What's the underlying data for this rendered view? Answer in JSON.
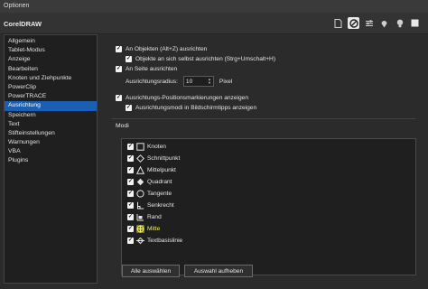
{
  "window": {
    "title": "Optionen"
  },
  "header": {
    "title": "CorelDRAW"
  },
  "header_icons": [
    "page-icon",
    "no-entry-icon",
    "sliders-icon",
    "pin-icon",
    "bulb-icon",
    "square-icon"
  ],
  "sidebar": {
    "items": [
      {
        "label": "Allgemein"
      },
      {
        "label": "Tablet-Modus"
      },
      {
        "label": "Anzeige"
      },
      {
        "label": "Bearbeiten"
      },
      {
        "label": "Knoten und Ziehpunkte"
      },
      {
        "label": "PowerClip"
      },
      {
        "label": "PowerTRACE"
      },
      {
        "label": "Ausrichtung",
        "selected": true
      },
      {
        "label": "Speichern"
      },
      {
        "label": "Text"
      },
      {
        "label": "Stifteinstellungen"
      },
      {
        "label": "Warnungen"
      },
      {
        "label": "VBA"
      },
      {
        "label": "Plugins"
      }
    ]
  },
  "options": {
    "snap_to_objects": "An Objekten  (Alt+Z) ausrichten",
    "snap_to_self": "Objekte an sich selbst ausrichten  (Strg+Umschalt+H)",
    "snap_to_page": "An Seite ausrichten",
    "radius_label": "Ausrichtungsradius:",
    "radius_value": "10",
    "radius_unit": "Pixel",
    "show_markers": "Ausrichtungs-Positionsmarkierungen anzeigen",
    "show_tooltips": "Ausrichtungsmodi in Bildschirmtipps anzeigen"
  },
  "modi": {
    "label": "Modi",
    "items": [
      {
        "label": "Knoten",
        "icon": "square-node-icon"
      },
      {
        "label": "Schnittpunkt",
        "icon": "intersection-icon"
      },
      {
        "label": "Mittelpunkt",
        "icon": "midpoint-icon"
      },
      {
        "label": "Quadrant",
        "icon": "quadrant-icon"
      },
      {
        "label": "Tangente",
        "icon": "tangent-icon"
      },
      {
        "label": "Senkrecht",
        "icon": "perpendicular-icon"
      },
      {
        "label": "Rand",
        "icon": "edge-icon"
      },
      {
        "label": "Mitte",
        "icon": "center-icon",
        "highlighted": true
      },
      {
        "label": "Textbasislinie",
        "icon": "text-baseline-icon"
      }
    ]
  },
  "buttons": {
    "select_all": "Alle auswählen",
    "deselect": "Auswahl aufheben"
  },
  "colors": {
    "selection": "#1a5fb4",
    "highlight": "#f0f05a"
  }
}
